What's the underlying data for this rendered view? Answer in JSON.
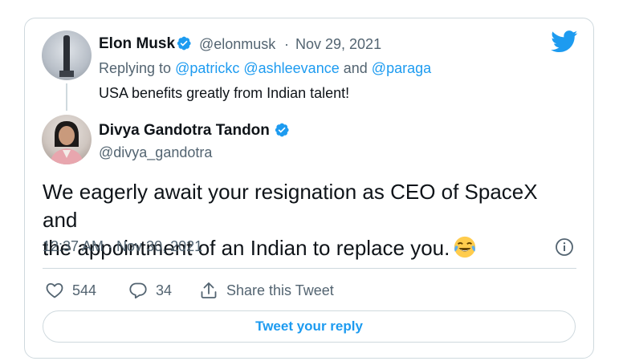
{
  "colors": {
    "accent": "#1d9bf0",
    "text": "#0f1419",
    "muted": "#536471",
    "border": "#cfd9de"
  },
  "parent_tweet": {
    "author_name": "Elon Musk",
    "handle": "@elonmusk",
    "separator": "·",
    "date": "Nov 29, 2021",
    "replying_prefix": "Replying to",
    "replying_to": "@patrickc @ashleevance",
    "replying_and": "and",
    "replying_last": "@paraga",
    "text": "USA benefits greatly from Indian talent!"
  },
  "tweet": {
    "author_name": "Divya Gandotra Tandon",
    "handle": "@divya_gandotra",
    "text_line1": "We eagerly await your resignation as CEO of SpaceX and",
    "text_line2": "the appointment of an Indian to replace you.",
    "emoji": "face-with-tears-of-joy",
    "timestamp": "12:37 AM · Nov 30, 2021"
  },
  "actions": {
    "likes": "544",
    "replies": "34",
    "share_label": "Share this Tweet"
  },
  "reply_button_label": "Tweet your reply",
  "icons": [
    "twitter-bird-icon",
    "verified-badge-icon",
    "info-icon",
    "heart-icon",
    "reply-bubble-icon",
    "share-icon"
  ]
}
